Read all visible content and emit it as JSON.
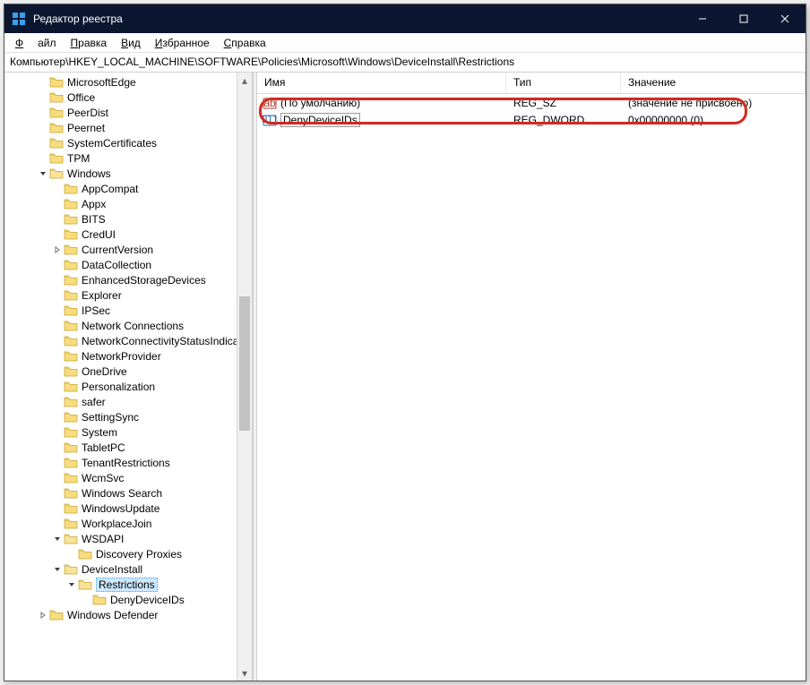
{
  "window": {
    "title": "Редактор реестра"
  },
  "win_controls": {
    "min": "minimize",
    "max": "maximize",
    "close": "close"
  },
  "menu": {
    "file": "Файл",
    "edit": "Правка",
    "view": "Вид",
    "favorites": "Избранное",
    "help": "Справка"
  },
  "addressbar": "Компьютер\\HKEY_LOCAL_MACHINE\\SOFTWARE\\Policies\\Microsoft\\Windows\\DeviceInstall\\Restrictions",
  "columns": {
    "name": "Имя",
    "type": "Тип",
    "value": "Значение"
  },
  "rows": [
    {
      "icon": "string",
      "name": "(По умолчанию)",
      "type": "REG_SZ",
      "value": "(значение не присвоено)",
      "selected": false
    },
    {
      "icon": "dword",
      "name": "DenyDeviceIDs",
      "type": "REG_DWORD",
      "value": "0x00000000 (0)",
      "selected": true
    }
  ],
  "tree": [
    {
      "d": 2,
      "chev": "",
      "label": "MicrosoftEdge"
    },
    {
      "d": 2,
      "chev": "",
      "label": "Office"
    },
    {
      "d": 2,
      "chev": "",
      "label": "PeerDist"
    },
    {
      "d": 2,
      "chev": "",
      "label": "Peernet"
    },
    {
      "d": 2,
      "chev": "",
      "label": "SystemCertificates"
    },
    {
      "d": 2,
      "chev": "",
      "label": "TPM"
    },
    {
      "d": 2,
      "chev": "v",
      "label": "Windows"
    },
    {
      "d": 3,
      "chev": "",
      "label": "AppCompat"
    },
    {
      "d": 3,
      "chev": "",
      "label": "Appx"
    },
    {
      "d": 3,
      "chev": "",
      "label": "BITS"
    },
    {
      "d": 3,
      "chev": "",
      "label": "CredUI"
    },
    {
      "d": 3,
      "chev": ">",
      "label": "CurrentVersion"
    },
    {
      "d": 3,
      "chev": "",
      "label": "DataCollection"
    },
    {
      "d": 3,
      "chev": "",
      "label": "EnhancedStorageDevices"
    },
    {
      "d": 3,
      "chev": "",
      "label": "Explorer"
    },
    {
      "d": 3,
      "chev": "",
      "label": "IPSec"
    },
    {
      "d": 3,
      "chev": "",
      "label": "Network Connections"
    },
    {
      "d": 3,
      "chev": "",
      "label": "NetworkConnectivityStatusIndicator"
    },
    {
      "d": 3,
      "chev": "",
      "label": "NetworkProvider"
    },
    {
      "d": 3,
      "chev": "",
      "label": "OneDrive"
    },
    {
      "d": 3,
      "chev": "",
      "label": "Personalization"
    },
    {
      "d": 3,
      "chev": "",
      "label": "safer"
    },
    {
      "d": 3,
      "chev": "",
      "label": "SettingSync"
    },
    {
      "d": 3,
      "chev": "",
      "label": "System"
    },
    {
      "d": 3,
      "chev": "",
      "label": "TabletPC"
    },
    {
      "d": 3,
      "chev": "",
      "label": "TenantRestrictions"
    },
    {
      "d": 3,
      "chev": "",
      "label": "WcmSvc"
    },
    {
      "d": 3,
      "chev": "",
      "label": "Windows Search"
    },
    {
      "d": 3,
      "chev": "",
      "label": "WindowsUpdate"
    },
    {
      "d": 3,
      "chev": "",
      "label": "WorkplaceJoin"
    },
    {
      "d": 3,
      "chev": "v",
      "label": "WSDAPI"
    },
    {
      "d": 4,
      "chev": "",
      "label": "Discovery Proxies"
    },
    {
      "d": 3,
      "chev": "v",
      "label": "DeviceInstall"
    },
    {
      "d": 4,
      "chev": "v",
      "label": "Restrictions",
      "selected": true
    },
    {
      "d": 5,
      "chev": "",
      "label": "DenyDeviceIDs"
    },
    {
      "d": 2,
      "chev": ">",
      "label": "Windows Defender"
    }
  ]
}
